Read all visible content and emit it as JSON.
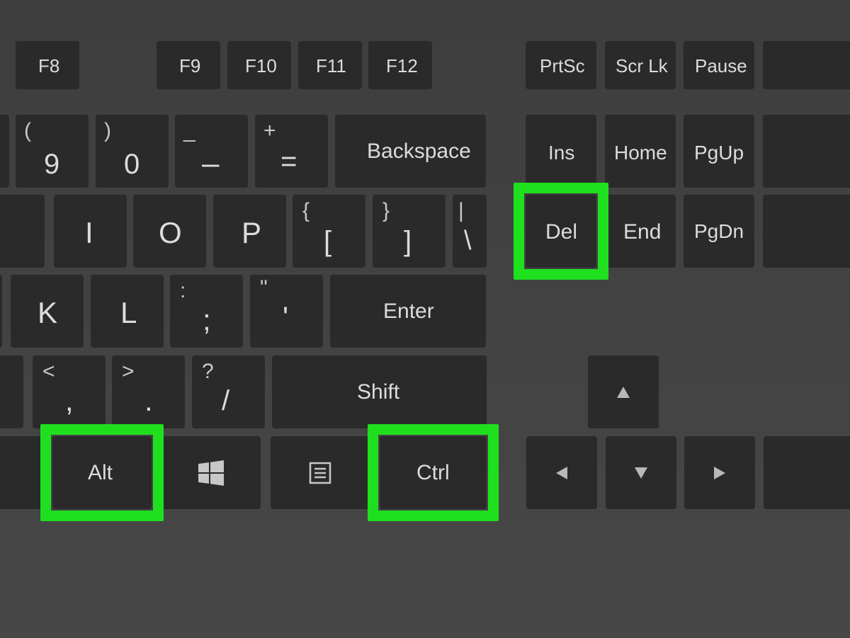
{
  "colors": {
    "highlight": "#1fe01f",
    "key": "#2a2a2a",
    "board": "#404040"
  },
  "highlighted": [
    "Del",
    "Alt",
    "Ctrl"
  ],
  "keys": {
    "f8": "F8",
    "f9": "F9",
    "f10": "F10",
    "f11": "F11",
    "f12": "F12",
    "prtsc": "PrtSc",
    "scrlk": "Scr Lk",
    "pause": "Pause",
    "nine_main": "9",
    "nine_shift": "(",
    "zero_main": "0",
    "zero_shift": ")",
    "minus_main": "–",
    "minus_shift": "_",
    "equals_main": "=",
    "equals_shift": "+",
    "backspace": "Backspace",
    "ins": "Ins",
    "home": "Home",
    "pgup": "PgUp",
    "i": "I",
    "o": "O",
    "p": "P",
    "lbracket_main": "[",
    "lbracket_shift": "{",
    "rbracket_main": "]",
    "rbracket_shift": "}",
    "backslash_main": "\\",
    "backslash_shift": "|",
    "del": "Del",
    "end": "End",
    "pgdn": "PgDn",
    "k": "K",
    "l": "L",
    "semicolon_main": ";",
    "semicolon_shift": ":",
    "apostrophe_main": "'",
    "apostrophe_shift": "\"",
    "enter": "Enter",
    "comma_main": ",",
    "comma_shift": "<",
    "period_main": ".",
    "period_shift": ">",
    "slash_main": "/",
    "slash_shift": "?",
    "shift": "Shift",
    "alt": "Alt",
    "ctrl": "Ctrl",
    "win_icon": "windows-icon",
    "menu_icon": "menu-icon",
    "up_icon": "arrow-up-icon",
    "down_icon": "arrow-down-icon",
    "left_icon": "arrow-left-icon",
    "right_icon": "arrow-right-icon"
  }
}
